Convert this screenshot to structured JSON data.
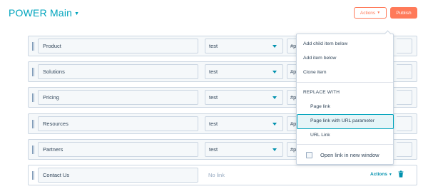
{
  "header": {
    "menu_title": "POWER Main",
    "actions_label": "Actions",
    "publish_label": "Publish"
  },
  "rows": [
    {
      "name": "Product",
      "type": "test",
      "url": "#p"
    },
    {
      "name": "Solutions",
      "type": "test",
      "url": "#p"
    },
    {
      "name": "Pricing",
      "type": "test",
      "url": "#p"
    },
    {
      "name": "Resources",
      "type": "test",
      "url": "#p"
    },
    {
      "name": "Partners",
      "type": "test",
      "url": "#p"
    }
  ],
  "last_row": {
    "name": "Contact Us",
    "link_text": "No link",
    "actions_label": "Actions"
  },
  "dropdown": {
    "add_child": "Add child item below",
    "add_item": "Add item below",
    "clone": "Clone item",
    "replace_heading": "REPLACE WITH",
    "page_link": "Page link",
    "page_link_url_param": "Page link with URL parameter",
    "url_link": "URL Link",
    "open_new_window": "Open link in new window",
    "open_new_window_checked": false
  },
  "colors": {
    "brand_teal": "#00a4bd",
    "accent_orange": "#ff7a59",
    "link_blue": "#0091ae",
    "border": "#cbd6e2"
  },
  "icons": [
    "caret-down-icon",
    "drag-handle-icon",
    "dropdown-arrow-icon",
    "trash-icon"
  ]
}
